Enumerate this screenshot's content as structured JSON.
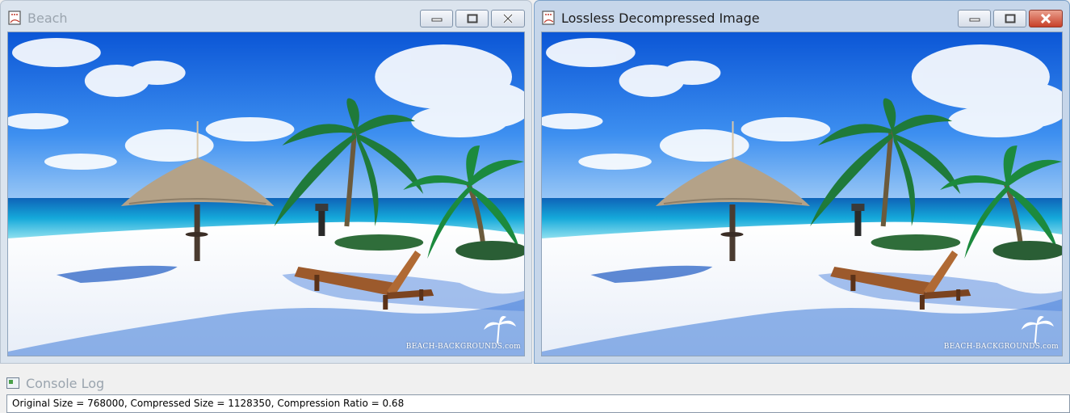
{
  "windows": [
    {
      "title": "Beach",
      "state": "inactive"
    },
    {
      "title": "Lossless Decompressed Image",
      "state": "active"
    }
  ],
  "image": {
    "watermark": "BEACH-BACKGROUNDS.com"
  },
  "console": {
    "title": "Console Log",
    "log_line": "Original Size = 768000, Compressed Size = 1128350, Compression Ratio = 0.68"
  },
  "icons": {
    "app": "image-document-icon",
    "minimize": "minimize-icon",
    "maximize": "maximize-icon",
    "close": "close-icon",
    "console": "console-window-icon"
  },
  "colors": {
    "close_active": "#c7402a",
    "sky": "#1a6ee6",
    "sea": "#14a6d6",
    "sand": "#f4f7fb"
  }
}
